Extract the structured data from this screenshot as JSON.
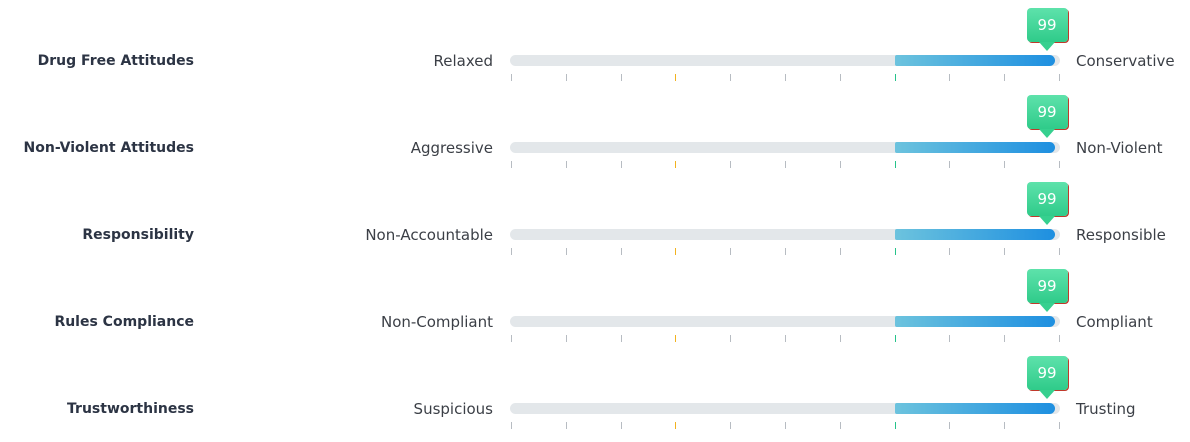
{
  "chart_data": {
    "type": "bar",
    "scale": [
      0,
      100
    ],
    "tick_count": 11,
    "tick_colors": {
      "default": "#b7bcc2",
      "mid": "#f2b21f",
      "high": "#26c38a"
    },
    "colors": {
      "track": "#e3e7ea",
      "fill_start": "#6cc3de",
      "fill_end": "#1e8fe0",
      "marker": "#36d08f"
    },
    "rows": [
      {
        "label": "Drug Free Attitudes",
        "low_label": "Relaxed",
        "high_label": "Conservative",
        "value": 99,
        "band_start": 70
      },
      {
        "label": "Non-Violent Attitudes",
        "low_label": "Aggressive",
        "high_label": "Non-Violent",
        "value": 99,
        "band_start": 70
      },
      {
        "label": "Responsibility",
        "low_label": "Non-Accountable",
        "high_label": "Responsible",
        "value": 99,
        "band_start": 70
      },
      {
        "label": "Rules Compliance",
        "low_label": "Non-Compliant",
        "high_label": "Compliant",
        "value": 99,
        "band_start": 70
      },
      {
        "label": "Trustworthiness",
        "low_label": "Suspicious",
        "high_label": "Trusting",
        "value": 99,
        "band_start": 70
      }
    ]
  }
}
